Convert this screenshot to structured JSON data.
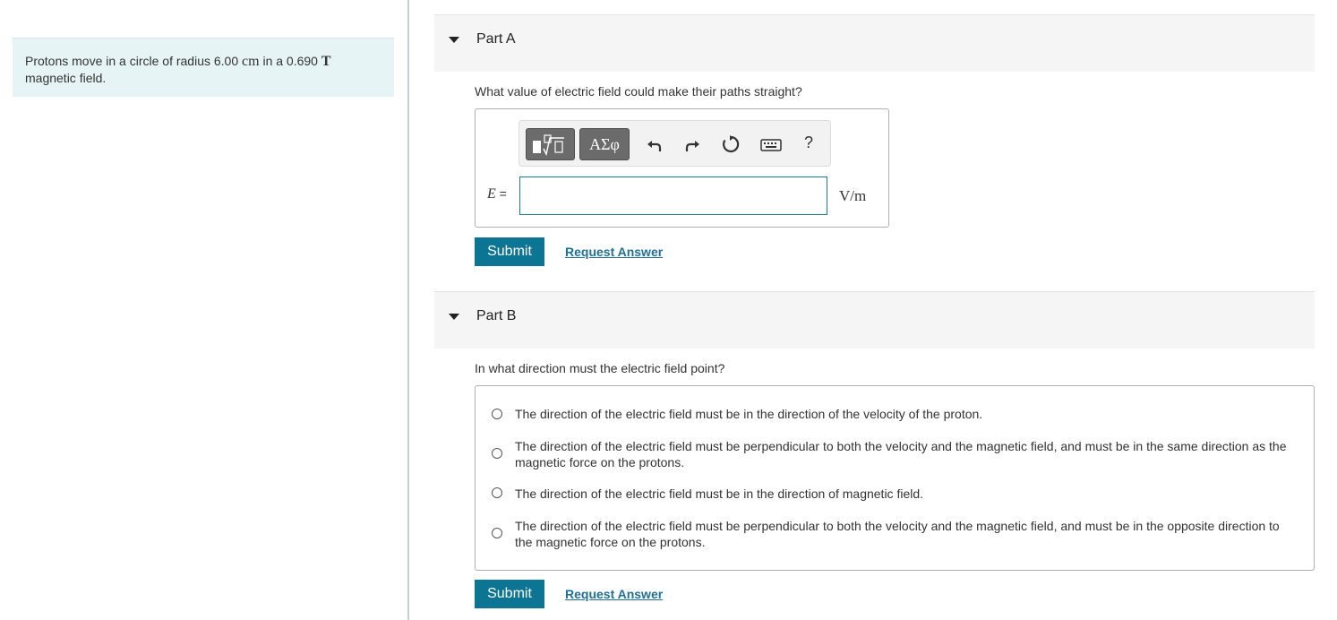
{
  "problem": {
    "text_before": "Protons move in a circle of radius 6.00 ",
    "unit_cm": "cm",
    "text_middle": " in a 0.690 ",
    "unit_T": "T",
    "text_after": "magnetic field."
  },
  "partA": {
    "title": "Part A",
    "question": "What value of electric field could make their paths straight?",
    "toolbar": {
      "greek_label": "ΑΣφ",
      "help_label": "?"
    },
    "equation_var": "E",
    "equation_eq": " =",
    "input_value": "",
    "unit": "V/m",
    "submit_label": "Submit",
    "request_label": "Request Answer"
  },
  "partB": {
    "title": "Part B",
    "question": "In what direction must the electric field point?",
    "choices": [
      "The direction of the electric field must be in the direction of the velocity of the proton.",
      "The direction of the electric field must be perpendicular to both the velocity and the magnetic field, and must be in the same direction as the magnetic force on the protons.",
      "The direction of the electric field must be in the direction of magnetic field.",
      "The direction of the electric field must be perpendicular to both the velocity and the magnetic field, and must be in the opposite direction to the magnetic force on the protons."
    ],
    "submit_label": "Submit",
    "request_label": "Request Answer"
  }
}
